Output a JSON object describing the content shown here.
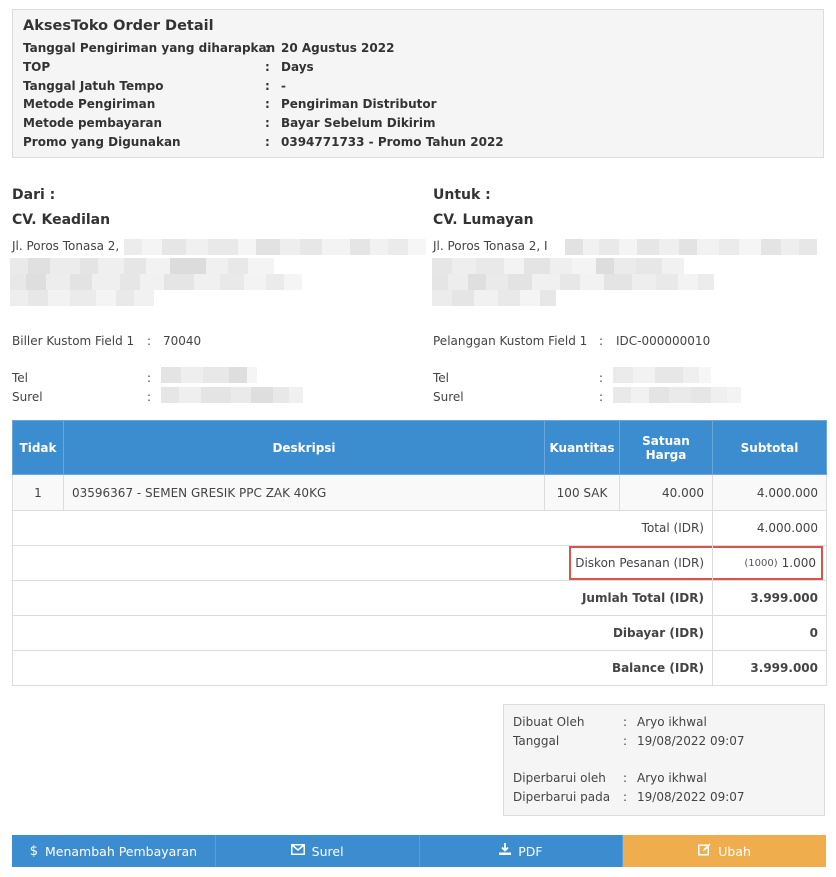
{
  "header": {
    "title": "AksesToko Order Detail",
    "rows": [
      {
        "label": "Tanggal Pengiriman yang diharapkan",
        "value": "20 Agustus 2022"
      },
      {
        "label": "TOP",
        "value": "Days"
      },
      {
        "label": "Tanggal Jatuh Tempo",
        "value": "-"
      },
      {
        "label": "Metode Pengiriman",
        "value": "Pengiriman Distributor"
      },
      {
        "label": "Metode pembayaran",
        "value": "Bayar Sebelum Dikirim"
      },
      {
        "label": "Promo yang Digunakan",
        "value": "0394771733 - Promo Tahun 2022"
      }
    ],
    "sep": ":"
  },
  "from": {
    "label": "Dari :",
    "name": "CV. Keadilan",
    "address": "Jl. Poros Tonasa 2,",
    "custom_field_label": "Biller Kustom Field 1",
    "custom_field_value": "70040",
    "tel_label": "Tel",
    "email_label": "Surel"
  },
  "to": {
    "label": "Untuk :",
    "name": "CV. Lumayan",
    "address": "Jl. Poros Tonasa 2, I",
    "custom_field_label": "Pelanggan Kustom Field 1",
    "custom_field_value": "IDC-000000010",
    "tel_label": "Tel",
    "email_label": "Surel"
  },
  "table": {
    "headers": {
      "no": "Tidak",
      "desc": "Deskripsi",
      "qty": "Kuantitas",
      "price": "Satuan Harga",
      "subtotal": "Subtotal"
    },
    "item": {
      "no": "1",
      "desc": "03596367 - SEMEN GRESIK PPC ZAK 40KG",
      "qty": "100 SAK",
      "price": "40.000",
      "subtotal": "4.000.000"
    },
    "total_label": "Total (IDR)",
    "total_value": "4.000.000",
    "discount_label": "Diskon Pesanan (IDR)",
    "discount_note": "(1000)",
    "discount_value": "1.000",
    "grand_label": "Jumlah Total (IDR)",
    "grand_value": "3.999.000",
    "paid_label": "Dibayar (IDR)",
    "paid_value": "0",
    "balance_label": "Balance (IDR)",
    "balance_value": "3.999.000"
  },
  "meta": {
    "created_by_label": "Dibuat Oleh",
    "created_by": "Aryo ikhwal",
    "date_label": "Tanggal",
    "date": "19/08/2022 09:07",
    "updated_by_label": "Diperbarui oleh",
    "updated_by": "Aryo ikhwal",
    "updated_at_label": "Diperbarui pada",
    "updated_at": "19/08/2022 09:07"
  },
  "buttons": {
    "add_payment": "Menambah Pembayaran",
    "email": "Surel",
    "pdf": "PDF",
    "edit": "Ubah"
  },
  "icons": {
    "add_payment": "dollar-icon",
    "email": "envelope-icon",
    "pdf": "download-icon",
    "edit": "edit-icon"
  },
  "colors": {
    "primary": "#3c8dd0",
    "warning": "#f0ad4e",
    "highlight": "#d9534f"
  }
}
